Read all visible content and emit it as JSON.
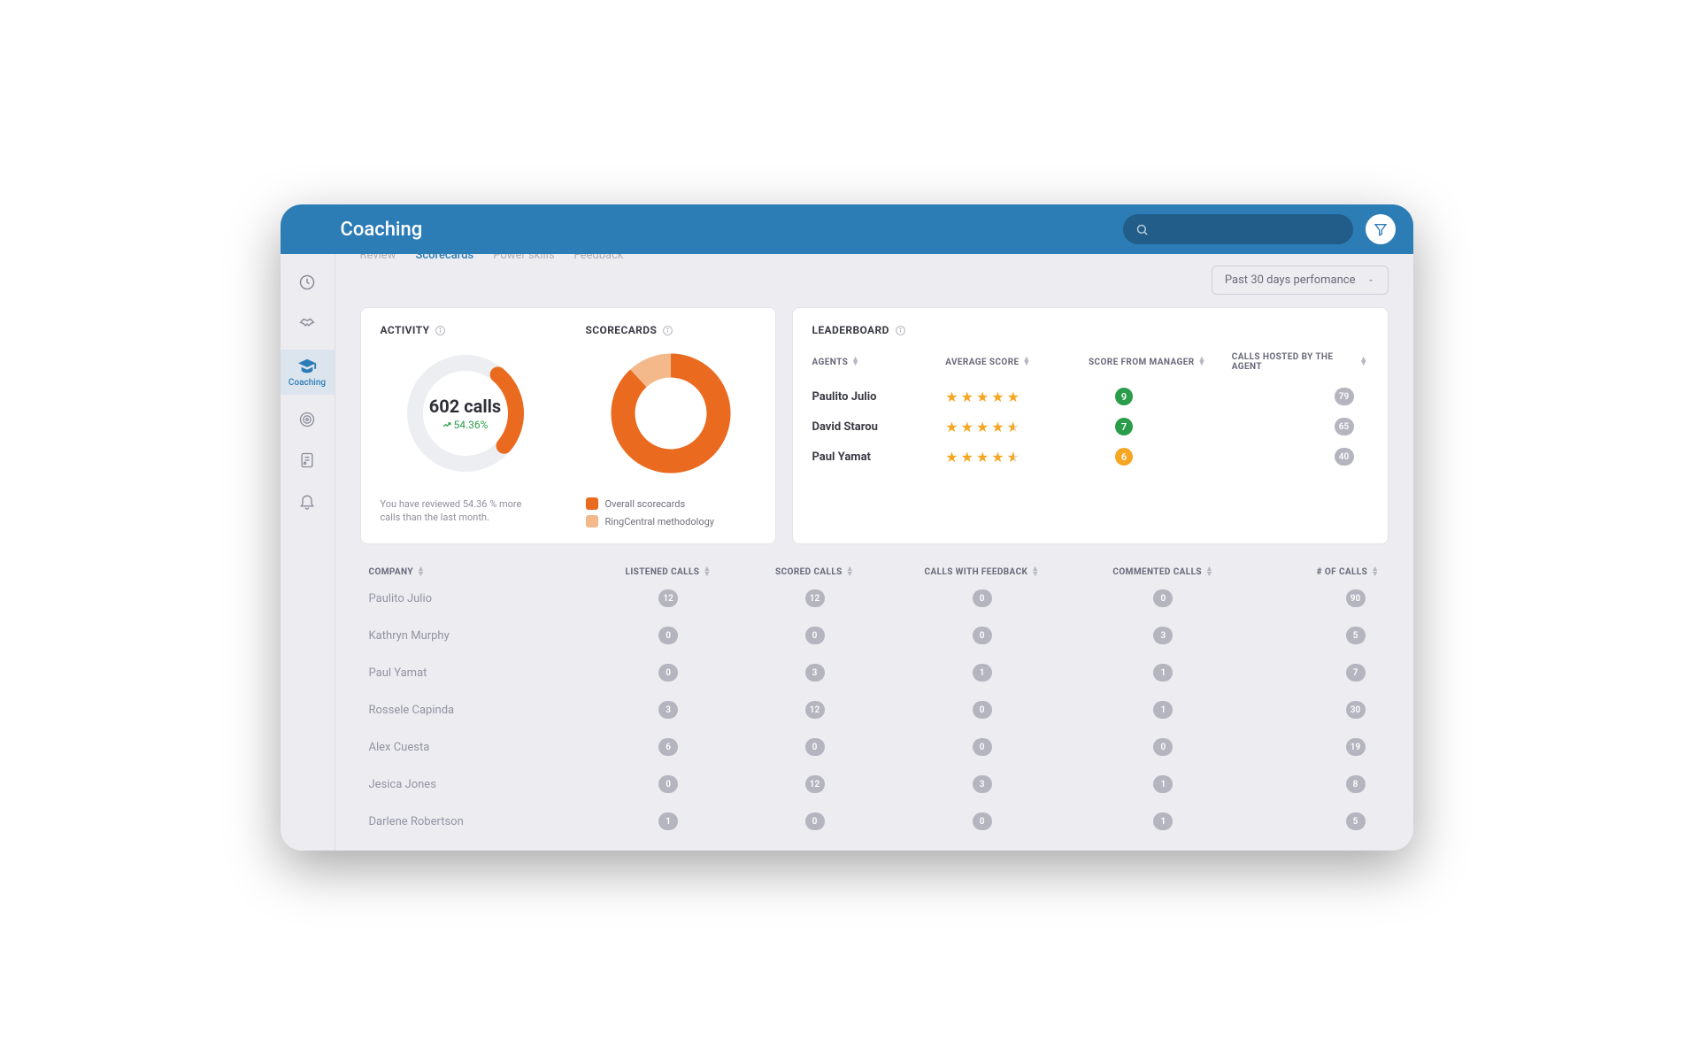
{
  "header": {
    "title": "Coaching"
  },
  "sidebar": {
    "active_index": 2,
    "items": [
      {
        "icon": "clock",
        "label": ""
      },
      {
        "icon": "handshake",
        "label": ""
      },
      {
        "icon": "gradcap",
        "label": "Coaching"
      },
      {
        "icon": "target",
        "label": ""
      },
      {
        "icon": "doc",
        "label": ""
      },
      {
        "icon": "bell",
        "label": ""
      }
    ]
  },
  "tabs": {
    "active_index": 1,
    "items": [
      "Review",
      "Scorecards",
      "Power skills",
      "Feedback"
    ]
  },
  "period": {
    "label": "Past 30 days perfomance"
  },
  "activity": {
    "title": "ACTIVITY",
    "calls_label": "602 calls",
    "pct_change": "54.36%",
    "note": "You have reviewed 54.36 % more calls than the last month.",
    "donut_fraction": 0.25
  },
  "scorecards": {
    "title": "SCORECARDS",
    "legend": [
      {
        "text": "Overall scorecards",
        "color": "#ea6a1f"
      },
      {
        "text": "RingCentral methodology",
        "color": "#f3b98a"
      }
    ],
    "primary_fraction": 0.88,
    "colors": {
      "primary": "#ea6a1f",
      "secondary": "#f3b98a"
    }
  },
  "leaderboard": {
    "title": "LEADERBOARD",
    "columns": [
      "AGENTS",
      "AVERAGE SCORE",
      "SCORE FROM MANAGER",
      "CALLS HOSTED BY THE AGENT"
    ],
    "rows": [
      {
        "name": "Paulito Julio",
        "stars": 5.0,
        "score": 9,
        "score_color": "green",
        "calls": 79
      },
      {
        "name": "David Starou",
        "stars": 4.5,
        "score": 7,
        "score_color": "green",
        "calls": 65
      },
      {
        "name": "Paul Yamat",
        "stars": 4.5,
        "score": 6,
        "score_color": "amber",
        "calls": 40
      }
    ]
  },
  "table": {
    "columns": [
      "COMPANY",
      "LISTENED CALLS",
      "SCORED CALLS",
      "CALLS WITH FEEDBACK",
      "COMMENTED CALLS",
      "# OF CALLS"
    ],
    "rows": [
      {
        "name": "Paulito Julio",
        "listened": 12,
        "scored": 12,
        "feedback": 0,
        "commented": 0,
        "calls": 90
      },
      {
        "name": "Kathryn Murphy",
        "listened": 0,
        "scored": 0,
        "feedback": 0,
        "commented": 3,
        "calls": 5
      },
      {
        "name": "Paul Yamat",
        "listened": 0,
        "scored": 3,
        "feedback": 1,
        "commented": 1,
        "calls": 7
      },
      {
        "name": "Rossele Capinda",
        "listened": 3,
        "scored": 12,
        "feedback": 0,
        "commented": 1,
        "calls": 30
      },
      {
        "name": "Alex Cuesta",
        "listened": 6,
        "scored": 0,
        "feedback": 0,
        "commented": 0,
        "calls": 19
      },
      {
        "name": "Jesica Jones",
        "listened": 0,
        "scored": 12,
        "feedback": 3,
        "commented": 1,
        "calls": 8
      },
      {
        "name": "Darlene Robertson",
        "listened": 1,
        "scored": 0,
        "feedback": 0,
        "commented": 1,
        "calls": 5
      }
    ]
  },
  "chart_data": [
    {
      "type": "pie",
      "title": "Activity",
      "series": [
        {
          "name": "reviewed_more",
          "values": [
            25
          ],
          "color": "#ea6a1f"
        },
        {
          "name": "remainder",
          "values": [
            75
          ],
          "color": "#edeef2"
        }
      ],
      "center_label": "602 calls",
      "delta_pct": 54.36
    },
    {
      "type": "pie",
      "title": "Scorecards",
      "series": [
        {
          "name": "Overall scorecards",
          "values": [
            88
          ],
          "color": "#ea6a1f"
        },
        {
          "name": "RingCentral methodology",
          "values": [
            12
          ],
          "color": "#f3b98a"
        }
      ]
    }
  ]
}
